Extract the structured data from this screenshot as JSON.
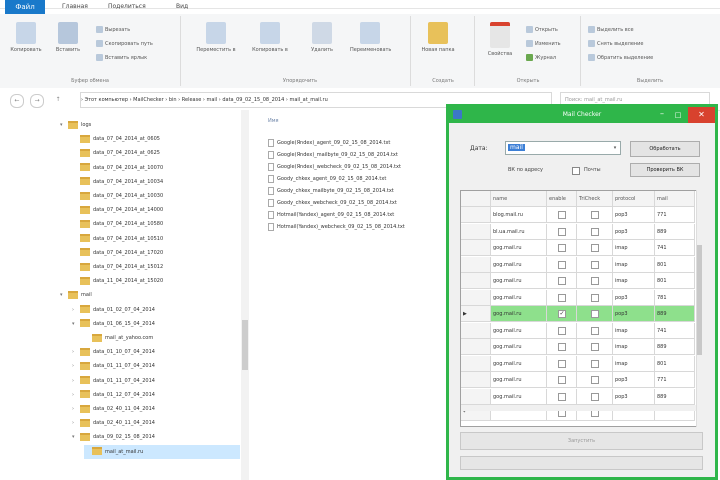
{
  "ribbon": {
    "file_tab": "Файл",
    "tabs": [
      "Главная",
      "Поделиться",
      "Вид"
    ],
    "groups": [
      {
        "label": "Буфер обмена",
        "big": [
          "Копировать",
          "Вставить"
        ],
        "small": [
          "Вырезать",
          "Скопировать путь",
          "Вставить ярлык"
        ]
      },
      {
        "label": "Упорядочить",
        "big": [
          "Переместить в",
          "Копировать в",
          "Удалить",
          "Переименовать"
        ],
        "small": []
      },
      {
        "label": "Создать",
        "big": [
          "Новая папка"
        ],
        "small": []
      },
      {
        "label": "Открыть",
        "big": [
          "Свойства"
        ],
        "small": [
          "Открыть",
          "Изменить",
          "Журнал"
        ]
      },
      {
        "label": "Выделить",
        "big": [],
        "small": [
          "Выделить все",
          "Снять выделение",
          "Обратить выделение"
        ]
      }
    ]
  },
  "address": {
    "path": "›  Этот компьютер  ›  MailChecker  ›  bin  ›  Release  ›  mail  ›  data_09_02_15_08_2014  ›  mail_at_mail.ru",
    "search_placeholder": "Поиск: mail_at_mail.ru",
    "nav": [
      "←",
      "→",
      "↑"
    ]
  },
  "tree": {
    "items": [
      {
        "label": "logs",
        "depth": 1,
        "arrow": "▾"
      },
      {
        "label": "data_07_04_2014_at_0605",
        "depth": 2,
        "arrow": ""
      },
      {
        "label": "data_07_04_2014_at_0625",
        "depth": 2,
        "arrow": ""
      },
      {
        "label": "data_07_04_2014_at_10070",
        "depth": 2,
        "arrow": ""
      },
      {
        "label": "data_07_04_2014_at_10034",
        "depth": 2,
        "arrow": ""
      },
      {
        "label": "data_07_04_2014_at_10030",
        "depth": 2,
        "arrow": ""
      },
      {
        "label": "data_07_04_2014_at_14000",
        "depth": 2,
        "arrow": ""
      },
      {
        "label": "data_07_04_2014_at_10580",
        "depth": 2,
        "arrow": ""
      },
      {
        "label": "data_07_04_2014_at_10510",
        "depth": 2,
        "arrow": ""
      },
      {
        "label": "data_07_04_2014_at_17020",
        "depth": 2,
        "arrow": ""
      },
      {
        "label": "data_07_04_2014_at_15012",
        "depth": 2,
        "arrow": ""
      },
      {
        "label": "data_11_04_2014_at_15020",
        "depth": 2,
        "arrow": ""
      },
      {
        "label": "mail",
        "depth": 1,
        "arrow": "▾"
      },
      {
        "label": "data_01_02_07_04_2014",
        "depth": 2,
        "arrow": "›"
      },
      {
        "label": "data_01_06_15_04_2014",
        "depth": 2,
        "arrow": "▾"
      },
      {
        "label": "mail_at_yahoo.com",
        "depth": 3,
        "arrow": ""
      },
      {
        "label": "data_01_10_07_04_2014",
        "depth": 2,
        "arrow": "›"
      },
      {
        "label": "data_01_11_07_04_2014",
        "depth": 2,
        "arrow": "›"
      },
      {
        "label": "data_01_11_07_04_2014",
        "depth": 2,
        "arrow": "›"
      },
      {
        "label": "data_01_12_07_04_2014",
        "depth": 2,
        "arrow": "›"
      },
      {
        "label": "data_02_40_11_04_2014",
        "depth": 2,
        "arrow": "›"
      },
      {
        "label": "data_02_40_11_04_2014",
        "depth": 2,
        "arrow": "›"
      },
      {
        "label": "data_09_02_15_08_2014",
        "depth": 2,
        "arrow": "▾"
      },
      {
        "label": "mail_at_mail.ru",
        "depth": 3,
        "arrow": "",
        "selected": true
      }
    ]
  },
  "filelist": {
    "column_name": "Имя",
    "files": [
      "Google(Яndex)_agent_09_02_15_08_2014.txt",
      "Google(Яndex)_mailbyte_09_02_15_08_2014.txt",
      "Google(Яndex)_webcheck_09_02_15_08_2014.txt",
      "Goody_chkex_agent_09_02_15_08_2014.txt",
      "Goody_chkex_mailbyte_09_02_15_08_2014.txt",
      "Goody_chkex_webcheck_09_02_15_08_2014.txt",
      "Hotmail(Yandex)_agent_09_02_15_08_2014.txt",
      "Hotmail(Yandex)_webcheck_09_02_15_08_2014.txt"
    ]
  },
  "dialog": {
    "title": "Mail Checker",
    "minimize": "–",
    "maximize": "□",
    "close": "✕",
    "date_label": "Дата:",
    "date_value": "mail",
    "dropdown_icon": "▾",
    "button_top": "Обработать",
    "button_top2": "Проверить ВК",
    "check_label1": "ВК по адресу",
    "check_label2": "Почты",
    "columns": [
      "name",
      "enable",
      "TriCheck",
      "protocol",
      "mail"
    ],
    "rows": [
      {
        "name": "blog.mail.ru",
        "enable": false,
        "tri": false,
        "protocol": "pop3",
        "mail": "771"
      },
      {
        "name": "bl.ua.mail.ru",
        "enable": false,
        "tri": false,
        "protocol": "pop3",
        "mail": "889"
      },
      {
        "name": "gog.mail.ru",
        "enable": false,
        "tri": false,
        "protocol": "imap",
        "mail": "741"
      },
      {
        "name": "gog.mail.ru",
        "enable": false,
        "tri": false,
        "protocol": "imap",
        "mail": "801"
      },
      {
        "name": "gog.mail.ru",
        "enable": false,
        "tri": false,
        "protocol": "imap",
        "mail": "801"
      },
      {
        "name": "gog.mail.ru",
        "enable": false,
        "tri": false,
        "protocol": "pop3",
        "mail": "781"
      },
      {
        "name": "gog.mail.ru",
        "enable": true,
        "tri": false,
        "protocol": "pop3",
        "mail": "889",
        "selected": true
      },
      {
        "name": "gog.mail.ru",
        "enable": false,
        "tri": false,
        "protocol": "imap",
        "mail": "741"
      },
      {
        "name": "gog.mail.ru",
        "enable": false,
        "tri": false,
        "protocol": "imap",
        "mail": "889"
      },
      {
        "name": "gog.mail.ru",
        "enable": false,
        "tri": false,
        "protocol": "imap",
        "mail": "801"
      },
      {
        "name": "gog.mail.ru",
        "enable": false,
        "tri": false,
        "protocol": "pop3",
        "mail": "771"
      },
      {
        "name": "gog.mail.ru",
        "enable": false,
        "tri": false,
        "protocol": "pop3",
        "mail": "889"
      },
      {
        "name": "",
        "enable": false,
        "tri": false,
        "protocol": "",
        "mail": "",
        "new_row": true
      }
    ],
    "button_bottom": "Запустить"
  },
  "colors": {
    "accent": "#2fb64a",
    "close": "#d8422e",
    "selected_row": "#8ee08c",
    "file_tab": "#1979ca"
  }
}
